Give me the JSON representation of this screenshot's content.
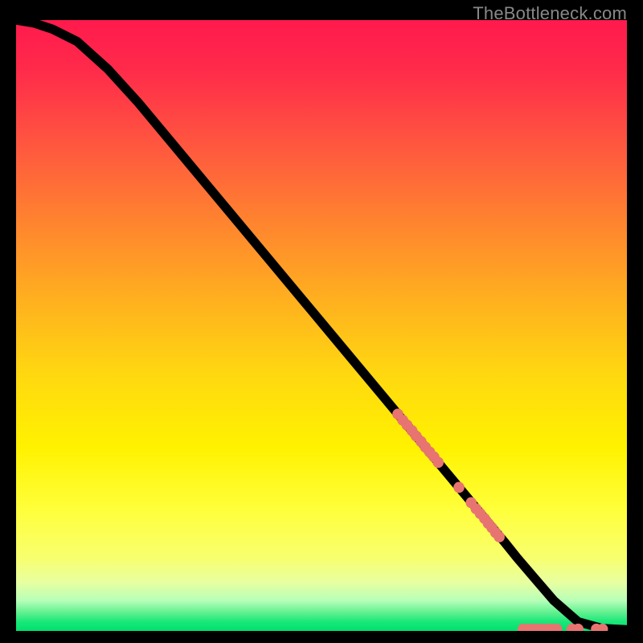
{
  "watermark": "TheBottleneck.com",
  "chart_data": {
    "type": "line",
    "title": "",
    "xlabel": "",
    "ylabel": "",
    "xlim": [
      0,
      100
    ],
    "ylim": [
      0,
      100
    ],
    "series": [
      {
        "name": "curve",
        "x": [
          0,
          3,
          6,
          10,
          15,
          20,
          25,
          30,
          35,
          40,
          45,
          50,
          55,
          60,
          65,
          70,
          75,
          80,
          82,
          85,
          88,
          92,
          96,
          100
        ],
        "y": [
          100,
          99.5,
          98.5,
          96.5,
          92,
          86.5,
          80.5,
          74.5,
          68.5,
          62.5,
          56.5,
          50.5,
          44.5,
          38.5,
          32.5,
          26.5,
          20.5,
          14.5,
          12,
          8.5,
          5,
          1.5,
          0.4,
          0.2
        ]
      }
    ],
    "scatter": [
      {
        "x": 62.5,
        "y": 35.5
      },
      {
        "x": 63.3,
        "y": 34.5
      },
      {
        "x": 64.0,
        "y": 33.7
      },
      {
        "x": 64.8,
        "y": 32.8
      },
      {
        "x": 65.5,
        "y": 31.9
      },
      {
        "x": 66.3,
        "y": 31.0
      },
      {
        "x": 67.0,
        "y": 30.1
      },
      {
        "x": 67.7,
        "y": 29.3
      },
      {
        "x": 68.4,
        "y": 28.5
      },
      {
        "x": 69.1,
        "y": 27.6
      },
      {
        "x": 72.5,
        "y": 23.5
      },
      {
        "x": 74.5,
        "y": 21.0
      },
      {
        "x": 75.3,
        "y": 20.0
      },
      {
        "x": 76.0,
        "y": 19.2
      },
      {
        "x": 76.7,
        "y": 18.4
      },
      {
        "x": 77.3,
        "y": 17.6
      },
      {
        "x": 77.9,
        "y": 16.9
      },
      {
        "x": 78.5,
        "y": 16.1
      },
      {
        "x": 79.1,
        "y": 15.4
      },
      {
        "x": 83.0,
        "y": 0.3
      },
      {
        "x": 83.8,
        "y": 0.3
      },
      {
        "x": 84.6,
        "y": 0.3
      },
      {
        "x": 85.4,
        "y": 0.3
      },
      {
        "x": 86.2,
        "y": 0.3
      },
      {
        "x": 87.0,
        "y": 0.3
      },
      {
        "x": 87.8,
        "y": 0.3
      },
      {
        "x": 88.5,
        "y": 0.3
      },
      {
        "x": 91.0,
        "y": 0.3
      },
      {
        "x": 92.0,
        "y": 0.3
      },
      {
        "x": 95.0,
        "y": 0.3
      },
      {
        "x": 96.0,
        "y": 0.3
      }
    ],
    "gradient_stops": [
      {
        "pos": 0,
        "color": "#ff1a4d"
      },
      {
        "pos": 0.5,
        "color": "#ffd810"
      },
      {
        "pos": 0.8,
        "color": "#ffff3a"
      },
      {
        "pos": 1.0,
        "color": "#00e070"
      }
    ]
  }
}
